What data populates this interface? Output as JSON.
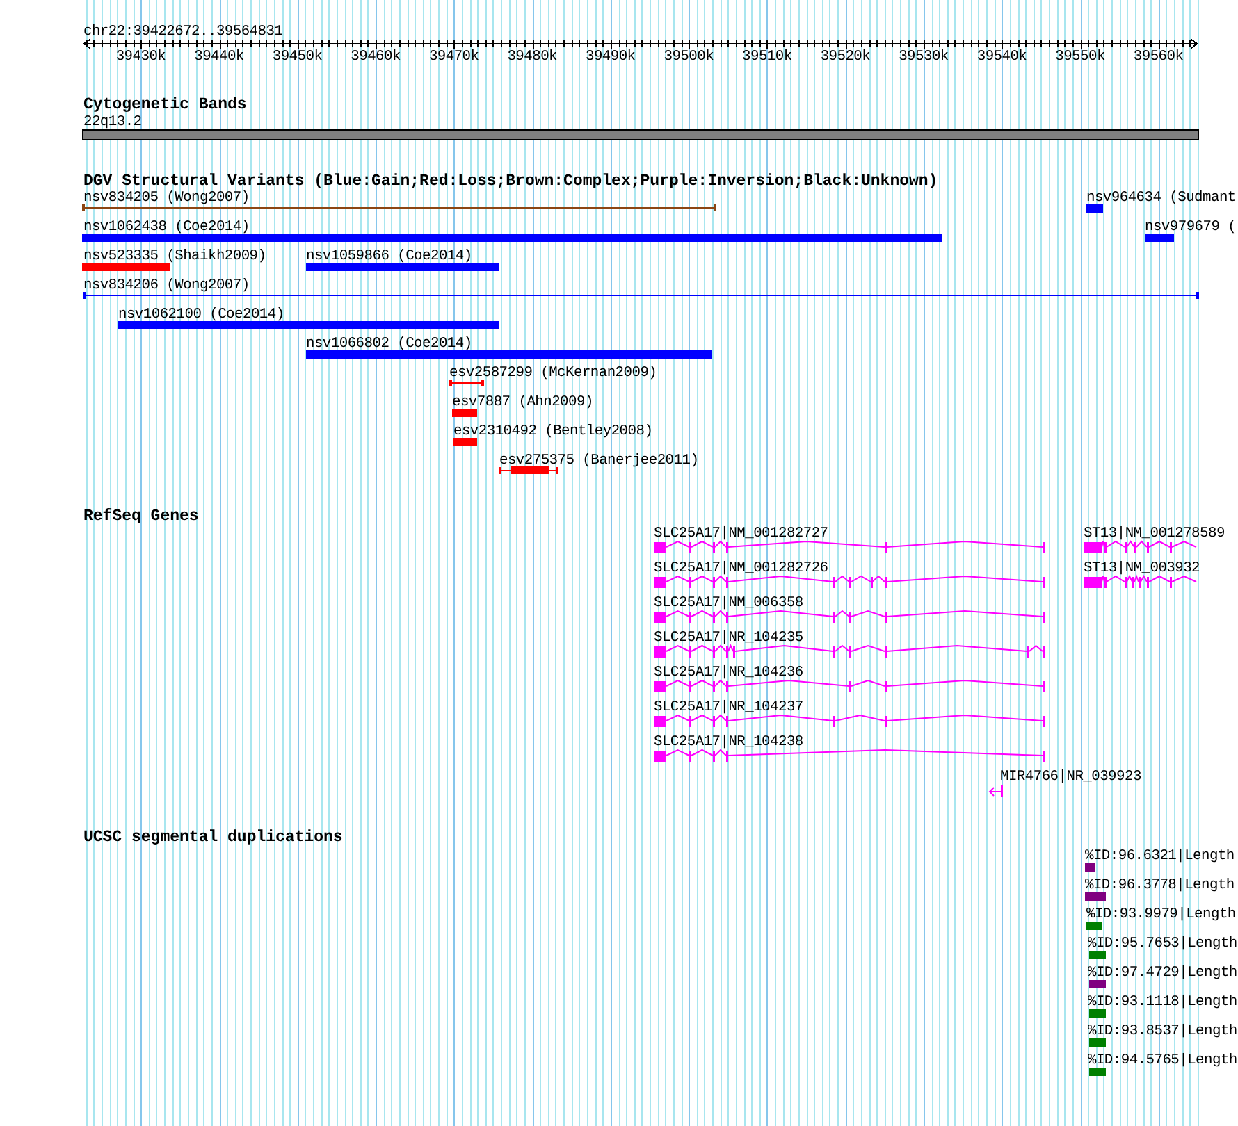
{
  "ruler": {
    "title": "chr22:39422672..39564831",
    "ticks": [
      "39430k",
      "39440k",
      "39450k",
      "39460k",
      "39470k",
      "39480k",
      "39490k",
      "39500k",
      "39510k",
      "39520k",
      "39530k",
      "39540k",
      "39550k",
      "39560k"
    ]
  },
  "tracks": [
    {
      "kind": "cytoband",
      "title": "Cytogenetic Bands",
      "features": [
        {
          "label": "22q13.2"
        }
      ]
    },
    {
      "kind": "variants",
      "title": "DGV Structural Variants (Blue:Gain;Red:Loss;Brown:Complex;Purple:Inversion;Black:Unknown)",
      "features": [
        {
          "label": "nsv834205 (Wong2007)",
          "kind": "line",
          "color": "#8b4513"
        },
        {
          "label": "nsv964634 (Sudmant",
          "kind": "bar",
          "color": "#0000ff"
        },
        {
          "label": "nsv1062438 (Coe2014)",
          "kind": "bar",
          "color": "#0000ff"
        },
        {
          "label": "nsv979679 (",
          "kind": "bar",
          "color": "#0000ff"
        },
        {
          "label": "nsv523335 (Shaikh2009)",
          "kind": "bar",
          "color": "#ff0000"
        },
        {
          "label": "nsv1059866 (Coe2014)",
          "kind": "bar",
          "color": "#0000ff"
        },
        {
          "label": "nsv834206 (Wong2007)",
          "kind": "line",
          "color": "#0000ff"
        },
        {
          "label": "nsv1062100 (Coe2014)",
          "kind": "bar",
          "color": "#0000ff"
        },
        {
          "label": "nsv1066802 (Coe2014)",
          "kind": "bar",
          "color": "#0000ff"
        },
        {
          "label": "esv2587299 (McKernan2009)",
          "kind": "line",
          "color": "#ff0000"
        },
        {
          "label": "esv7887 (Ahn2009)",
          "kind": "bar",
          "color": "#ff0000"
        },
        {
          "label": "esv2310492 (Bentley2008)",
          "kind": "bar",
          "color": "#ff0000"
        },
        {
          "label": "esv275375 (Banerjee2011)",
          "kind": "span",
          "color": "#ff0000"
        }
      ]
    },
    {
      "kind": "genes",
      "title": "RefSeq Genes",
      "features": [
        {
          "label": "SLC25A17|NM_001282727",
          "kind": "transcript"
        },
        {
          "label": "ST13|NM_001278589",
          "kind": "transcript"
        },
        {
          "label": "SLC25A17|NM_001282726",
          "kind": "transcript"
        },
        {
          "label": "ST13|NM_003932",
          "kind": "transcript"
        },
        {
          "label": "SLC25A17|NM_006358",
          "kind": "transcript"
        },
        {
          "label": "SLC25A17|NR_104235",
          "kind": "transcript"
        },
        {
          "label": "SLC25A17|NR_104236",
          "kind": "transcript"
        },
        {
          "label": "SLC25A17|NR_104237",
          "kind": "transcript"
        },
        {
          "label": "SLC25A17|NR_104238",
          "kind": "transcript"
        },
        {
          "label": "MIR4766|NR_039923",
          "kind": "arrow"
        }
      ]
    },
    {
      "kind": "segdups",
      "title": "UCSC segmental duplications",
      "features": [
        {
          "label": "%ID:96.6321|Length",
          "color": "#800080"
        },
        {
          "label": "%ID:96.3778|Length",
          "color": "#800080"
        },
        {
          "label": "%ID:93.9979|Length",
          "color": "#008000"
        },
        {
          "label": "%ID:95.7653|Length",
          "color": "#008000"
        },
        {
          "label": "%ID:97.4729|Length",
          "color": "#800080"
        },
        {
          "label": "%ID:93.1118|Length",
          "color": "#008000"
        },
        {
          "label": "%ID:93.8537|Length",
          "color": "#008000"
        },
        {
          "label": "%ID:94.5765|Length",
          "color": "#008000"
        }
      ]
    }
  ]
}
